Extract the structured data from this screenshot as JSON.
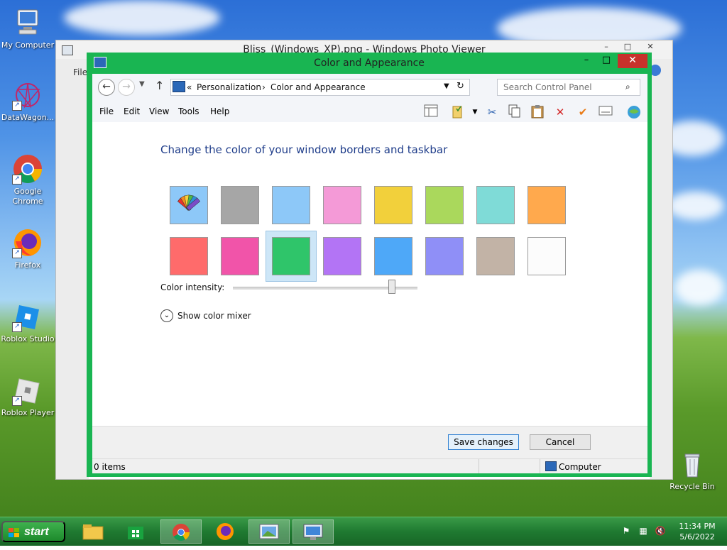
{
  "desktop": {
    "icons": [
      {
        "label": "My Computer"
      },
      {
        "label": "DataWagon..."
      },
      {
        "label": "Google Chrome"
      },
      {
        "label": "Firefox"
      },
      {
        "label": "Roblox Studio"
      },
      {
        "label": "Roblox Player"
      },
      {
        "label": "Recycle Bin"
      }
    ]
  },
  "photo_viewer": {
    "title": "Bliss_(Windows_XP).png - Windows Photo Viewer",
    "file_menu": "File"
  },
  "window": {
    "title": "Color and Appearance",
    "minimize": "–",
    "maximize": "□",
    "close": "✕",
    "breadcrumb": {
      "separator": "«",
      "parent": "Personalization",
      "arrow": "›",
      "current": "Color and Appearance"
    },
    "search_placeholder": "Search Control Panel",
    "menu": [
      "File",
      "Edit",
      "View",
      "Tools",
      "Help"
    ],
    "heading": "Change the color of your window borders and taskbar",
    "swatches": [
      "#ffffff",
      "#a6a6a6",
      "#8dc8f8",
      "#f49ad7",
      "#f2d03b",
      "#aad85c",
      "#7fdbd7",
      "#ffa94d",
      "#ff6b6b",
      "#f154a9",
      "#2fc56a",
      "#b374f5",
      "#4ea8f8",
      "#8f8ff7",
      "#c2b3a6",
      "#fcfcfc"
    ],
    "selected_swatch_index": 10,
    "intensity_label": "Color intensity:",
    "intensity_value": 0.86,
    "mixer_label": "Show color mixer",
    "save_label": "Save changes",
    "cancel_label": "Cancel",
    "status_items": "0 items",
    "status_computer": "Computer"
  },
  "taskbar": {
    "start_label": "start",
    "time": "11:34 PM",
    "date": "5/6/2022"
  },
  "colors": {
    "accent": "#19b552",
    "taskbar": "#1f7a31"
  }
}
